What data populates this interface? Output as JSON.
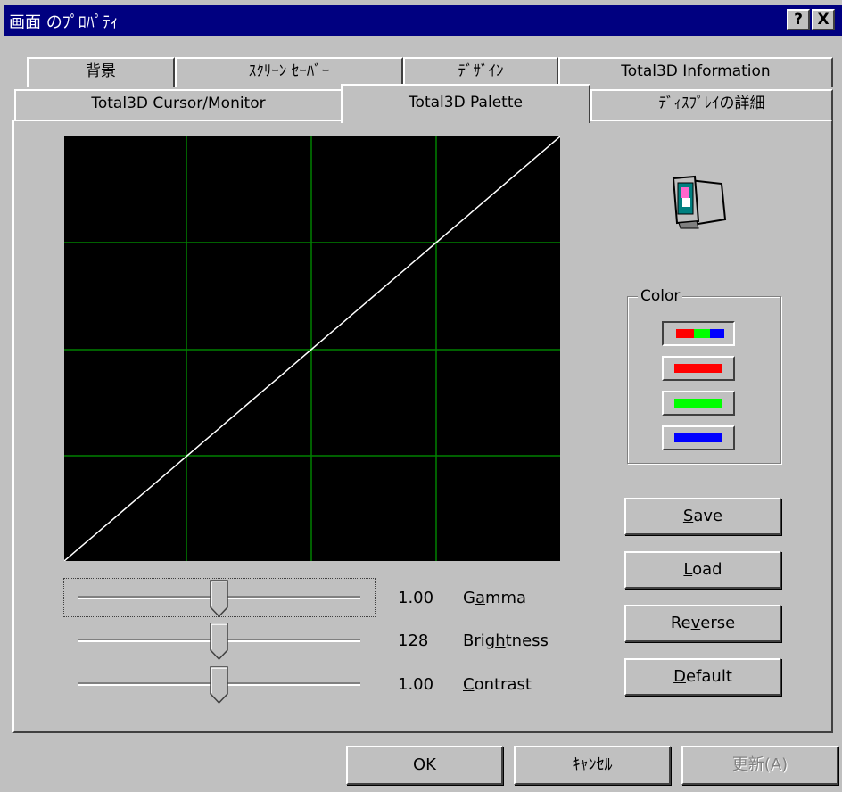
{
  "window": {
    "title": "画面 のﾌﾟﾛﾊﾟﾃｨ",
    "help_button": "?",
    "close_button": "X"
  },
  "tabs_back": [
    "背景",
    "ｽｸﾘｰﾝ ｾｰﾊﾞｰ",
    "ﾃﾞｻﾞｲﾝ",
    "Total3D Information"
  ],
  "tabs_front": [
    "Total3D Cursor/Monitor",
    "Total3D Palette",
    "ﾃﾞｨｽﾌﾟﾚｲの詳細"
  ],
  "active_tab": "Total3D Palette",
  "graph": {
    "grid_color": "#008000",
    "curve_color": "#ffffff",
    "background": "#000000"
  },
  "sliders": [
    {
      "value": "1.00",
      "label_pre": "G",
      "label_u": "a",
      "label_post": "mma",
      "position": 0.5
    },
    {
      "value": "128",
      "label_pre": "Brig",
      "label_u": "h",
      "label_post": "tness",
      "position": 0.5
    },
    {
      "value": "1.00",
      "label_pre": "",
      "label_u": "C",
      "label_post": "ontrast",
      "position": 0.5
    }
  ],
  "color_group": {
    "label": "Color",
    "buttons": [
      "all",
      "red",
      "green",
      "blue"
    ],
    "colors": {
      "red": "#ff0000",
      "green": "#00ff00",
      "blue": "#0000ff"
    }
  },
  "action_buttons": {
    "save": {
      "u": "S",
      "rest": "ave"
    },
    "load": {
      "u": "L",
      "rest": "oad"
    },
    "reverse": {
      "pre": "Re",
      "u": "v",
      "rest": "erse"
    },
    "default": {
      "u": "D",
      "rest": "efault"
    }
  },
  "dialog_buttons": {
    "ok": "OK",
    "cancel": "ｷｬﾝｾﾙ",
    "apply": "更新(A)"
  }
}
